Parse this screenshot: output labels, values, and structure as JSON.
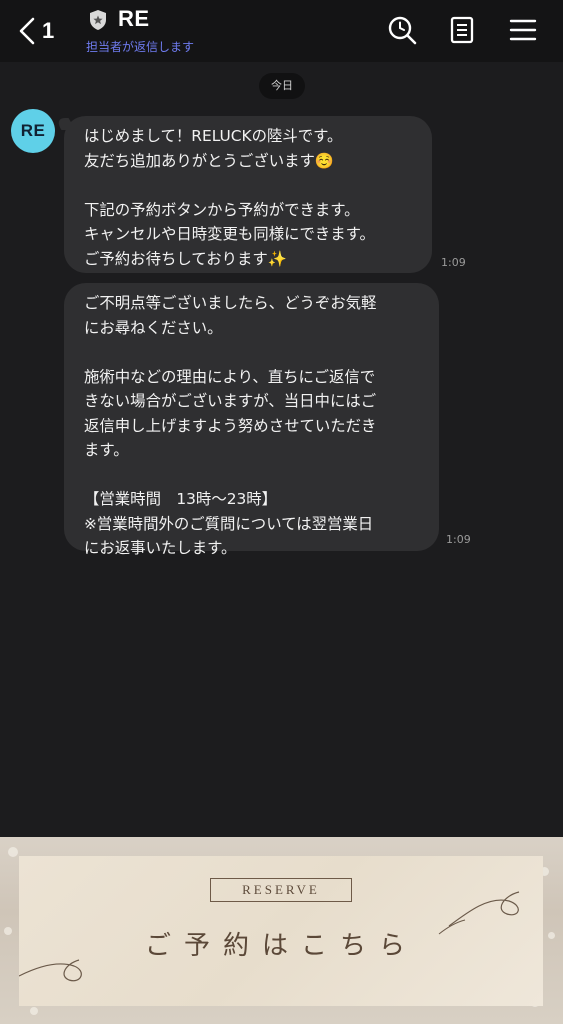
{
  "header": {
    "unread_count": "1",
    "title": "RE",
    "subtitle": "担当者が返信します",
    "icons": [
      "back-chevron-icon",
      "official-shield-icon",
      "search-icon",
      "notes-icon",
      "menu-icon"
    ]
  },
  "date_divider": "今日",
  "sender": {
    "avatar_text": "RE"
  },
  "messages": [
    {
      "text": "はじめまして！RELUCKの陸斗です。\n友だち追加ありがとうございます☺️\n\n下記の予約ボタンから予約ができます。\nキャンセルや日時変更も同様にできます。\nご予約お待ちしております✨",
      "time": "1:09"
    },
    {
      "text": "ご不明点等ございましたら、どうぞお気軽\nにお尋ねください。\n\n施術中などの理由により、直ちにご返信で\nきない場合がございますが、当日中にはご\n返信申し上げますよう努めさせていただき\nます。\n\n【営業時間　13時～23時】\n※営業時間外のご質問については翌営業日\nにお返事いたします。",
      "time": "1:09"
    }
  ],
  "banner": {
    "label": "RESERVE",
    "cta": "ご予約はこちら"
  },
  "colors": {
    "background": "#1c1c1e",
    "header": "#141415",
    "bubble": "#2f2f31",
    "subtitle": "#6f7cf0",
    "avatar": "#5fd0e8",
    "banner_text": "#5b4838"
  }
}
